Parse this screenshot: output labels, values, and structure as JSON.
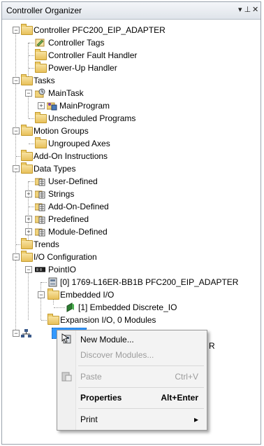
{
  "panel": {
    "title": "Controller Organizer",
    "pin_glyph": "▾ ⊥",
    "close_glyph": "✕"
  },
  "tree": {
    "controller": "Controller PFC200_EIP_ADAPTER",
    "controller_tags": "Controller Tags",
    "controller_fault_handler": "Controller Fault Handler",
    "power_up_handler": "Power-Up Handler",
    "tasks": "Tasks",
    "main_task": "MainTask",
    "main_program": "MainProgram",
    "unscheduled_programs": "Unscheduled Programs",
    "motion_groups": "Motion Groups",
    "ungrouped_axes": "Ungrouped Axes",
    "add_on_instructions": "Add-On Instructions",
    "data_types": "Data Types",
    "user_defined": "User-Defined",
    "strings": "Strings",
    "add_on_defined": "Add-On-Defined",
    "predefined": "Predefined",
    "module_defined": "Module-Defined",
    "trends": "Trends",
    "io_configuration": "I/O Configuration",
    "point_io": "PointIO",
    "module_1769": "[0] 1769-L16ER-BB1B PFC200_EIP_ADAPTER",
    "embedded_io": "Embedded I/O",
    "embedded_discrete": "[1] Embedded Discrete_IO",
    "expansion_io": "Expansion I/O, 0 Modules",
    "truncated_tail": "R"
  },
  "context_menu": {
    "new_module": "New Module...",
    "discover_modules": "Discover Modules...",
    "paste": "Paste",
    "paste_shortcut": "Ctrl+V",
    "properties": "Properties",
    "properties_shortcut": "Alt+Enter",
    "print": "Print",
    "submenu_arrow": "▸"
  },
  "icons": {
    "folder": "folder-icon",
    "tags": "tags-icon",
    "task": "task-icon",
    "program": "program-icon",
    "datatype": "datatype-icon",
    "module": "module-icon",
    "network": "network-icon",
    "paste": "paste-icon"
  },
  "colors": {
    "folder": "#e8c05a",
    "selection": "#3399ff",
    "menu_bg": "#f3f3f3"
  }
}
